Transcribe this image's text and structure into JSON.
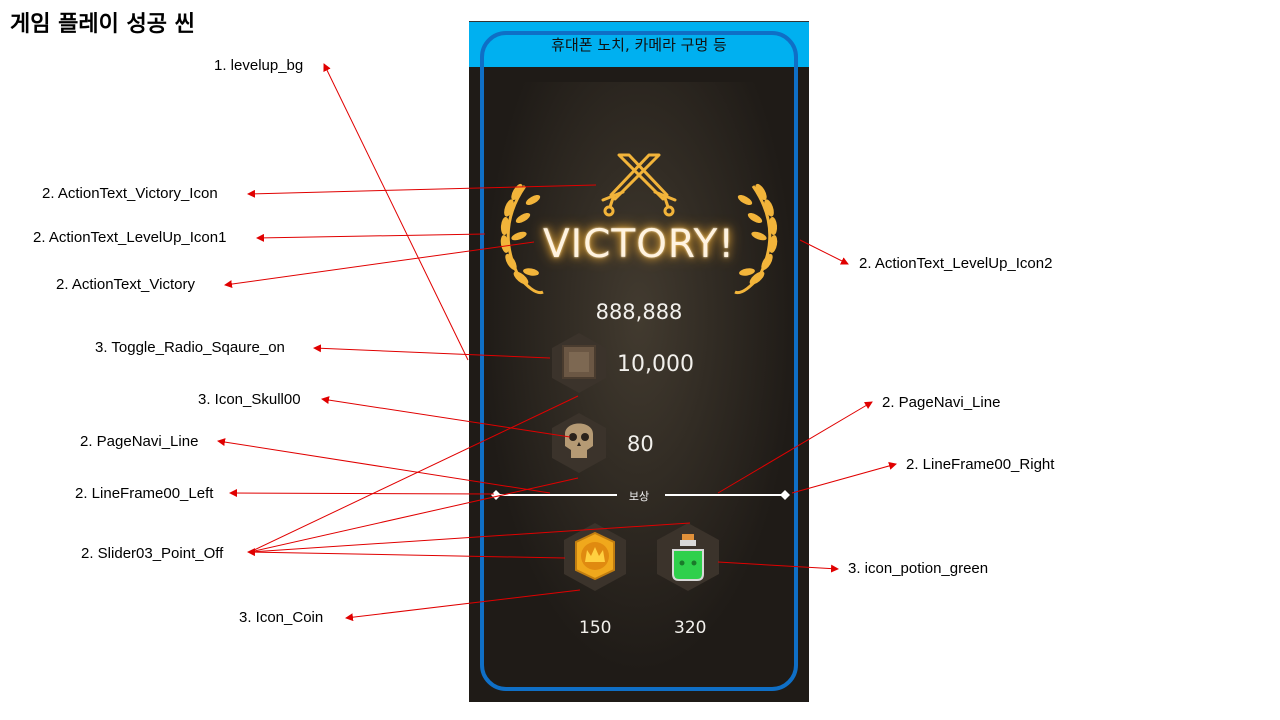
{
  "title": "게임 플레이 성공 씬",
  "phone": {
    "notch_text": "휴대폰 노치, 카메라 구멍 등",
    "victory_text": "VICTORY!",
    "score": "888,888",
    "gold_reward": "10,000",
    "kill_count": "80",
    "reward_label": "보상",
    "coin_count": "150",
    "potion_count": "320"
  },
  "labels": {
    "levelup_bg": "1. levelup_bg",
    "victory_icon": "2. ActionText_Victory_Icon",
    "levelup_icon1": "2. ActionText_LevelUp_Icon1",
    "victory": "2. ActionText_Victory",
    "levelup_icon2": "2. ActionText_LevelUp_Icon2",
    "toggle_radio": "3. Toggle_Radio_Sqaure_on",
    "icon_skull": "3. Icon_Skull00",
    "pagenavi_left": "2. PageNavi_Line",
    "pagenavi_right": "2. PageNavi_Line",
    "lineframe_left": "2. LineFrame00_Left",
    "lineframe_right": "2. LineFrame00_Right",
    "slider_point": "2. Slider03_Point_Off",
    "icon_potion": "3. icon_potion_green",
    "icon_coin": "3. Icon_Coin"
  },
  "colors": {
    "notch": "#00b0f0",
    "safe_frame": "#0f6fc6",
    "background": "#1f1b17",
    "accent_gold": "#f2b43a",
    "arrow": "#e00000"
  }
}
